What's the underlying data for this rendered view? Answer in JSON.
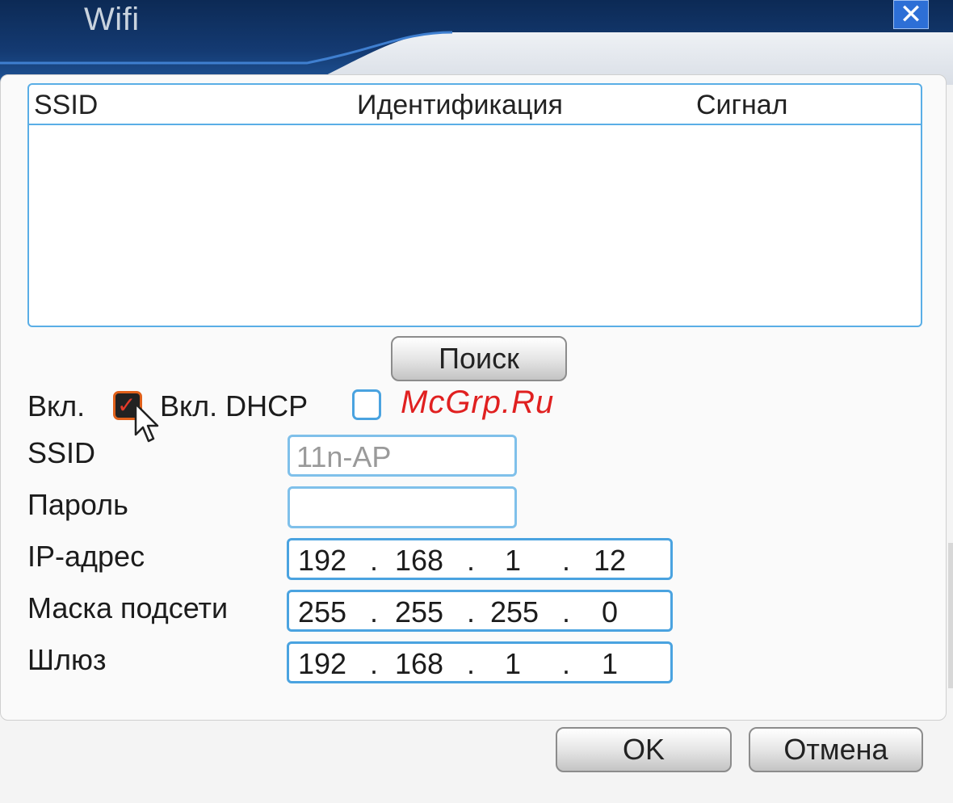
{
  "window": {
    "title": "Wifi",
    "close_icon": "close-icon",
    "accent": "#0c2a55"
  },
  "network_list": {
    "columns": [
      "SSID",
      "Идентификация",
      "Сигнал"
    ],
    "rows": []
  },
  "search_button": {
    "label": "Поиск"
  },
  "enable": {
    "label": "Вкл.",
    "checked": true
  },
  "dhcp": {
    "label": "Вкл. DHCP",
    "checked": false
  },
  "watermark": "McGrp.Ru",
  "ssid": {
    "label": "SSID",
    "value": "11n-AP"
  },
  "password": {
    "label": "Пароль",
    "value": ""
  },
  "ip_address": {
    "label": "IP-адрес",
    "octets": [
      "192",
      "168",
      "1",
      "12"
    ]
  },
  "subnet_mask": {
    "label": "Маска подсети",
    "octets": [
      "255",
      "255",
      "255",
      "0"
    ]
  },
  "gateway": {
    "label": "Шлюз",
    "octets": [
      "192",
      "168",
      "1",
      "1"
    ]
  },
  "footer": {
    "ok_label": "OK",
    "cancel_label": "Отмена"
  }
}
